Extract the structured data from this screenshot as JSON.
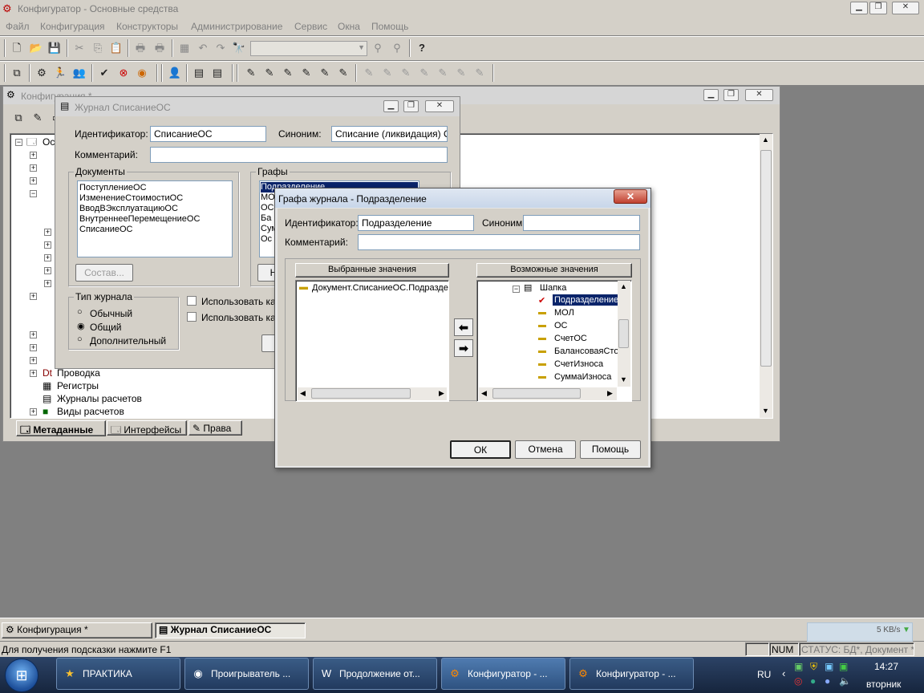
{
  "app": {
    "title": "Конфигуратор - Основные средства"
  },
  "menu": [
    "Файл",
    "Конфигурация",
    "Конструкторы",
    "Администрирование",
    "Сервис",
    "Окна",
    "Помощь"
  ],
  "config_window": {
    "title": "Конфигурация *",
    "tree": [
      "Ос",
      "Проводка",
      "Регистры",
      "Журналы расчетов",
      "Виды расчетов"
    ],
    "tabs": [
      "Метаданные",
      "Интерфейсы",
      "Права"
    ]
  },
  "journal_dialog": {
    "title": "Журнал СписаниеОС",
    "id_label": "Идентификатор:",
    "id_value": "СписаниеОС",
    "syn_label": "Синоним:",
    "syn_value": "Списание (ликвидация) ОС",
    "comment_label": "Комментарий:",
    "comment_value": "",
    "docs_label": "Документы",
    "docs": [
      "ПоступлениеОС",
      "ИзменениеСтоимостиОС",
      "ВводВЭксплуатациюОС",
      "ВнутреннееПеремещениеОС",
      "СписаниеОС"
    ],
    "sostav_btn": "Состав...",
    "grafy_label": "Графы",
    "grafy": [
      "Подразделение",
      "МО",
      "ОС",
      "Ба",
      "Сум",
      "Ос"
    ],
    "grafy_btn": "Н",
    "type_label": "Тип журнала",
    "types": [
      "Обычный",
      "Общий",
      "Дополнительный"
    ],
    "selected_type": "Общий",
    "checks": [
      "Использовать ка",
      "Использовать ка"
    ]
  },
  "column_dialog": {
    "title": "Графа журнала -  Подразделение",
    "id_label": "Идентификатор:",
    "id_value": "Подразделение",
    "syn_label": "Синоним:",
    "syn_value": "",
    "comment_label": "Комментарий:",
    "comment_value": "",
    "selected_header": "Выбранные значения",
    "selected_items": [
      "Документ.СписаниеОС.Подразде"
    ],
    "possible_header": "Возможные значения",
    "tree": [
      {
        "label": "Шапка",
        "icon": "header-icon"
      },
      {
        "label": "Подразделение",
        "icon": "check-icon",
        "selected": true
      },
      {
        "label": "МОЛ",
        "icon": "folder-icon"
      },
      {
        "label": "ОС",
        "icon": "folder-icon"
      },
      {
        "label": "СчетОС",
        "icon": "folder-icon"
      },
      {
        "label": "БалансоваяСто",
        "icon": "folder-icon"
      },
      {
        "label": "СчетИзноса",
        "icon": "folder-icon"
      },
      {
        "label": "СуммаИзноса",
        "icon": "folder-icon"
      }
    ],
    "ok": "ОК",
    "cancel": "Отмена",
    "help": "Помощь"
  },
  "windows_bar": [
    "Конфигурация *",
    "Журнал СписаниеОС"
  ],
  "status": {
    "hint": "Для получения подсказки нажмите F1",
    "num": "NUM",
    "status_text": "СТАТУС: БД*, Документ *",
    "speed": "5 KB/s"
  },
  "taskbar": {
    "items": [
      "ПРАКТИКА",
      "Проигрыватель ...",
      "Продолжение от...",
      "Конфигуратор - ...",
      "Конфигуратор - ..."
    ],
    "lang": "RU",
    "time": "14:27",
    "day": "вторник"
  },
  "colors": {
    "selection": "#0a246a",
    "face": "#d4d0c8",
    "taskbar": "#1c2f4d"
  }
}
